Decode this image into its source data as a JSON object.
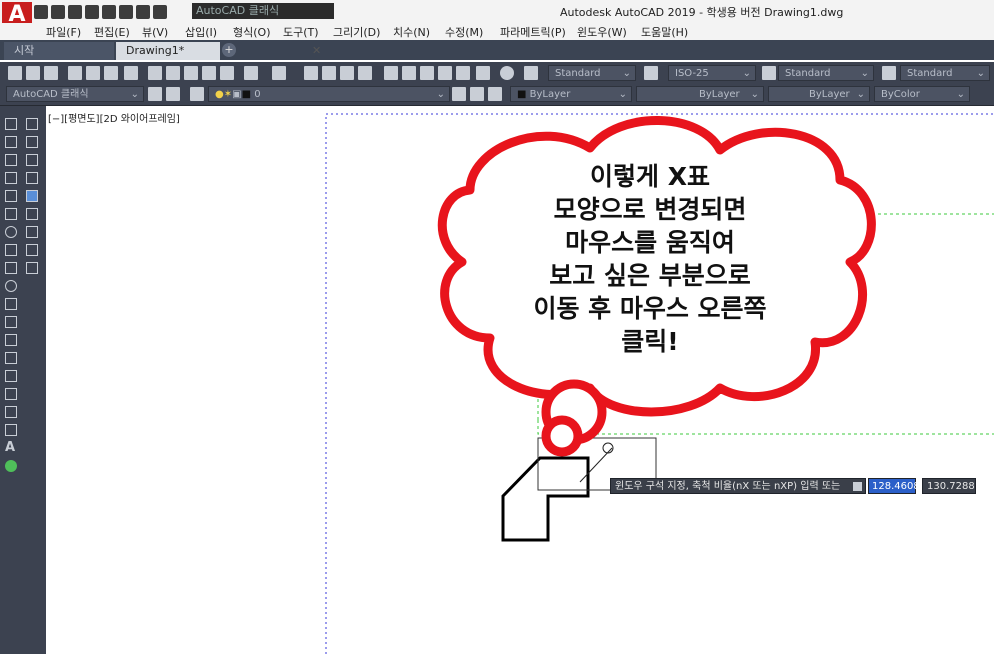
{
  "app": {
    "logo": "A",
    "title": "Autodesk AutoCAD 2019 - 학생용 버전    Drawing1.dwg",
    "workspace": "AutoCAD 클래식"
  },
  "menu": [
    "파일(F)",
    "편집(E)",
    "뷰(V)",
    "삽입(I)",
    "형식(O)",
    "도구(T)",
    "그리기(D)",
    "치수(N)",
    "수정(M)",
    "파라메트릭(P)",
    "윈도우(W)",
    "도움말(H)"
  ],
  "tabs": {
    "start": "시작",
    "drawing": "Drawing1*",
    "close": "✕",
    "add": "+"
  },
  "toolbar": {
    "text_style": "Standard",
    "dim_style": "ISO-25",
    "table_style": "Standard",
    "mleader_style": "Standard",
    "workspace_combo": "AutoCAD 클래식",
    "layer": "0",
    "color": "ByLayer",
    "linetype": "ByLayer",
    "lineweight": "ByLayer",
    "plotstyle": "ByColor"
  },
  "viewport_label": "[−][평면도][2D 와이어프레임]",
  "callout": {
    "lines": [
      "이렇게 X표",
      "모양으로 변경되면",
      "마우스를 움직여",
      "보고 싶은 부분으로",
      "이동 후 마우스 오른쪽",
      "클릭!"
    ],
    "stroke_color": "#e8141c"
  },
  "prompt": {
    "text": "윈도우 구석 지정, 축척 비율(nX 또는 nXP) 입력 또는",
    "value_x": "128.4608",
    "value_y": "130.7288"
  },
  "colors": {
    "accent": "#c81e1e",
    "toolbar_bg": "#3c4250",
    "highlight": "#2b5fc9",
    "limit_green": "#3cc83c"
  }
}
